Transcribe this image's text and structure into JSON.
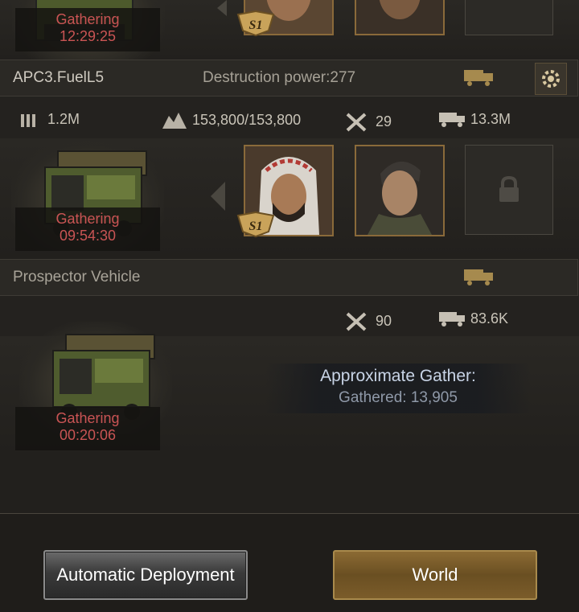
{
  "row0": {
    "gather_status": "Gathering",
    "gather_time": "12:29:25"
  },
  "row1": {
    "vehicle_name": "APC3.FuelL5",
    "destruction_power": "Destruction power:277",
    "ammo": "1.2M",
    "capacity": "153,800/153,800",
    "repair": "29",
    "load": "13.3M",
    "gather_status": "Gathering",
    "gather_time": "09:54:30"
  },
  "row2": {
    "vehicle_name": "Prospector Vehicle",
    "repair": "90",
    "load": "83.6K",
    "gather_status": "Gathering",
    "gather_time": "00:20:06",
    "approx_label": "Approximate Gather:",
    "approx_value": "Gathered: 13,905"
  },
  "buttons": {
    "auto_deploy": "Automatic Deployment",
    "world": "World"
  },
  "hero_badge": "S1",
  "colors": {
    "accent_gold": "#8a6a3a",
    "gathering_red": "#c95454"
  }
}
